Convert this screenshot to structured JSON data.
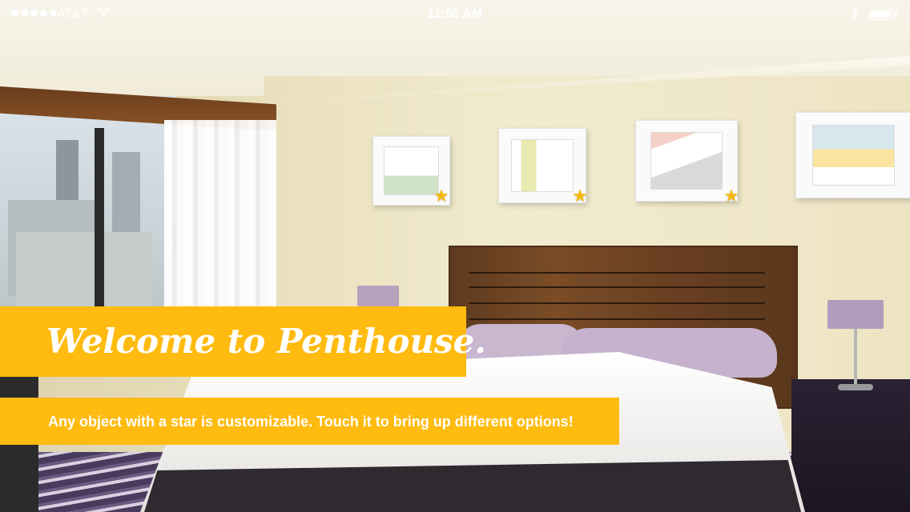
{
  "status_bar": {
    "carrier": "AT&T",
    "time": "11:56 AM",
    "signal_bars": 5,
    "battery_level": 1.0,
    "icons": [
      "signal-dots-icon",
      "wifi-icon",
      "bluetooth-icon",
      "battery-icon"
    ]
  },
  "scene": {
    "customizable_items": [
      {
        "name": "framed-art-1",
        "star_icon": "star-icon"
      },
      {
        "name": "framed-art-2",
        "star_icon": "star-icon"
      },
      {
        "name": "framed-art-3",
        "star_icon": "star-icon"
      }
    ]
  },
  "overlay": {
    "title": "Welcome to Penthouse.",
    "hint": "Any object with a star is customizable. Touch it to bring up different options!"
  },
  "colors": {
    "accent": "#ffbb0f",
    "star": "#f5b80f",
    "text_on_accent": "#ffffff"
  }
}
